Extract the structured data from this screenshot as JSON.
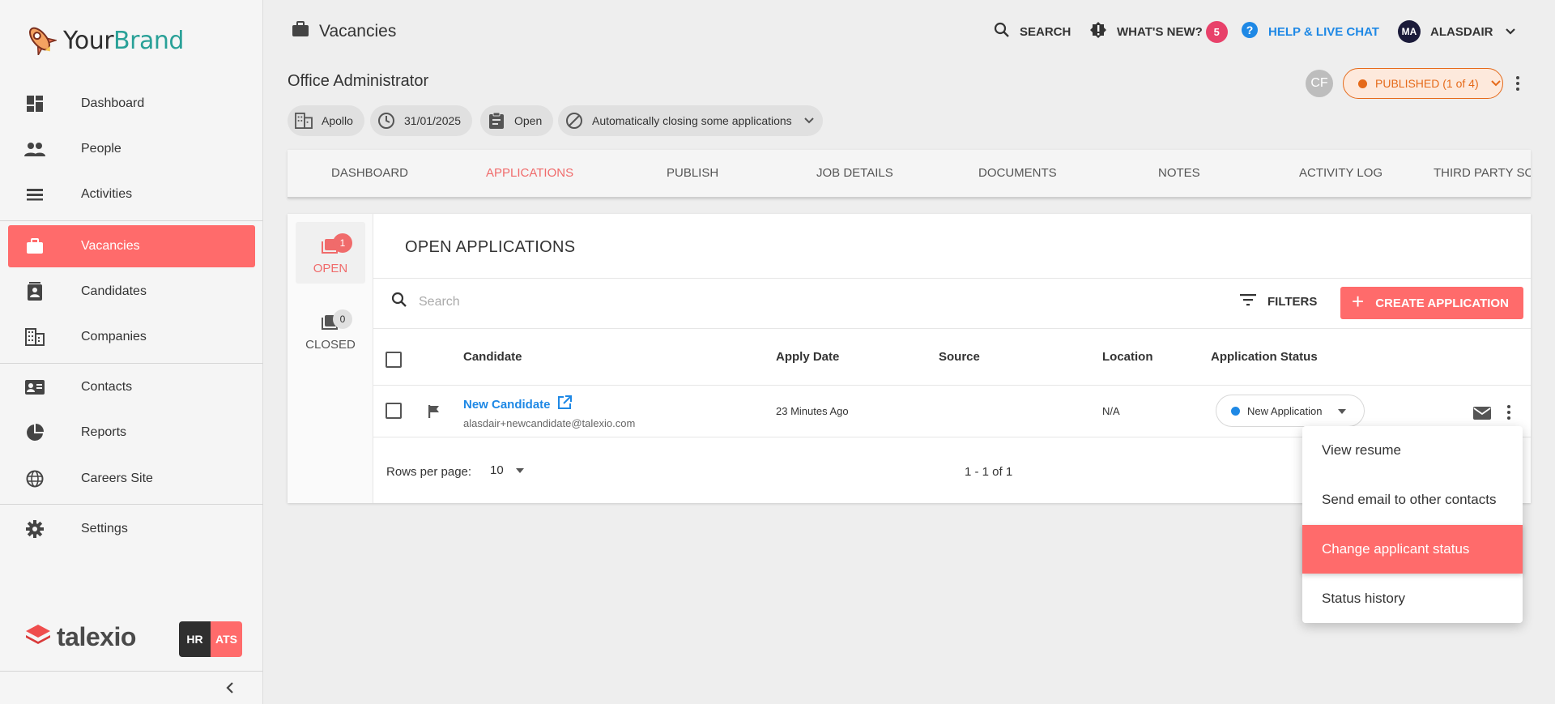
{
  "brand": {
    "part1": "Your",
    "part2": "Brand"
  },
  "sidebar": {
    "items": [
      {
        "label": "Dashboard",
        "icon": "dashboard-icon"
      },
      {
        "label": "People",
        "icon": "people-icon"
      },
      {
        "label": "Activities",
        "icon": "activities-icon"
      },
      {
        "label": "Vacancies",
        "icon": "briefcase-icon",
        "active": true
      },
      {
        "label": "Candidates",
        "icon": "candidate-badge-icon"
      },
      {
        "label": "Companies",
        "icon": "building-icon"
      },
      {
        "label": "Contacts",
        "icon": "contact-card-icon"
      },
      {
        "label": "Reports",
        "icon": "pie-chart-icon"
      },
      {
        "label": "Careers Site",
        "icon": "globe-icon"
      },
      {
        "label": "Settings",
        "icon": "gear-icon"
      }
    ],
    "footer": {
      "product": "talexio",
      "hr": "HR",
      "ats": "ATS"
    }
  },
  "header": {
    "page_title": "Vacancies",
    "search_label": "SEARCH",
    "whats_new_label": "WHAT'S NEW?",
    "whats_new_count": "5",
    "help_label": "HELP & LIVE CHAT",
    "user_initials": "MA",
    "user_name": "ALASDAIR"
  },
  "vacancy": {
    "title": "Office Administrator",
    "chips": {
      "company": "Apollo",
      "date": "31/01/2025",
      "state": "Open",
      "auto_close": "Automatically closing some applications"
    },
    "owner_initials": "CF",
    "published_label": "PUBLISHED (1 of 4)"
  },
  "tabs": [
    "DASHBOARD",
    "APPLICATIONS",
    "PUBLISH",
    "JOB DETAILS",
    "DOCUMENTS",
    "NOTES",
    "ACTIVITY LOG",
    "THIRD PARTY SO"
  ],
  "applications": {
    "open_label": "OPEN",
    "open_count": "1",
    "closed_label": "CLOSED",
    "closed_count": "0",
    "section_title": "OPEN APPLICATIONS",
    "search_placeholder": "Search",
    "filters_label": "FILTERS",
    "create_label": "CREATE APPLICATION",
    "columns": [
      "Candidate",
      "Apply Date",
      "Source",
      "Location",
      "Application Status"
    ],
    "rows": [
      {
        "name": "New Candidate",
        "email": "alasdair+newcandidate@talexio.com",
        "apply_date": "23 Minutes Ago",
        "source": "",
        "location": "N/A",
        "status": "New Application"
      }
    ],
    "rows_per_page_label": "Rows per page:",
    "rows_per_page": "10",
    "range": "1 - 1 of 1"
  },
  "context_menu": {
    "items": [
      "View resume",
      "Send email to other contacts",
      "Change applicant status",
      "Status history"
    ],
    "highlighted_index": 2
  },
  "colors": {
    "accent": "#ff6b6b",
    "link": "#1e88e5",
    "published": "#e56a1a",
    "teal": "#2aa198"
  }
}
